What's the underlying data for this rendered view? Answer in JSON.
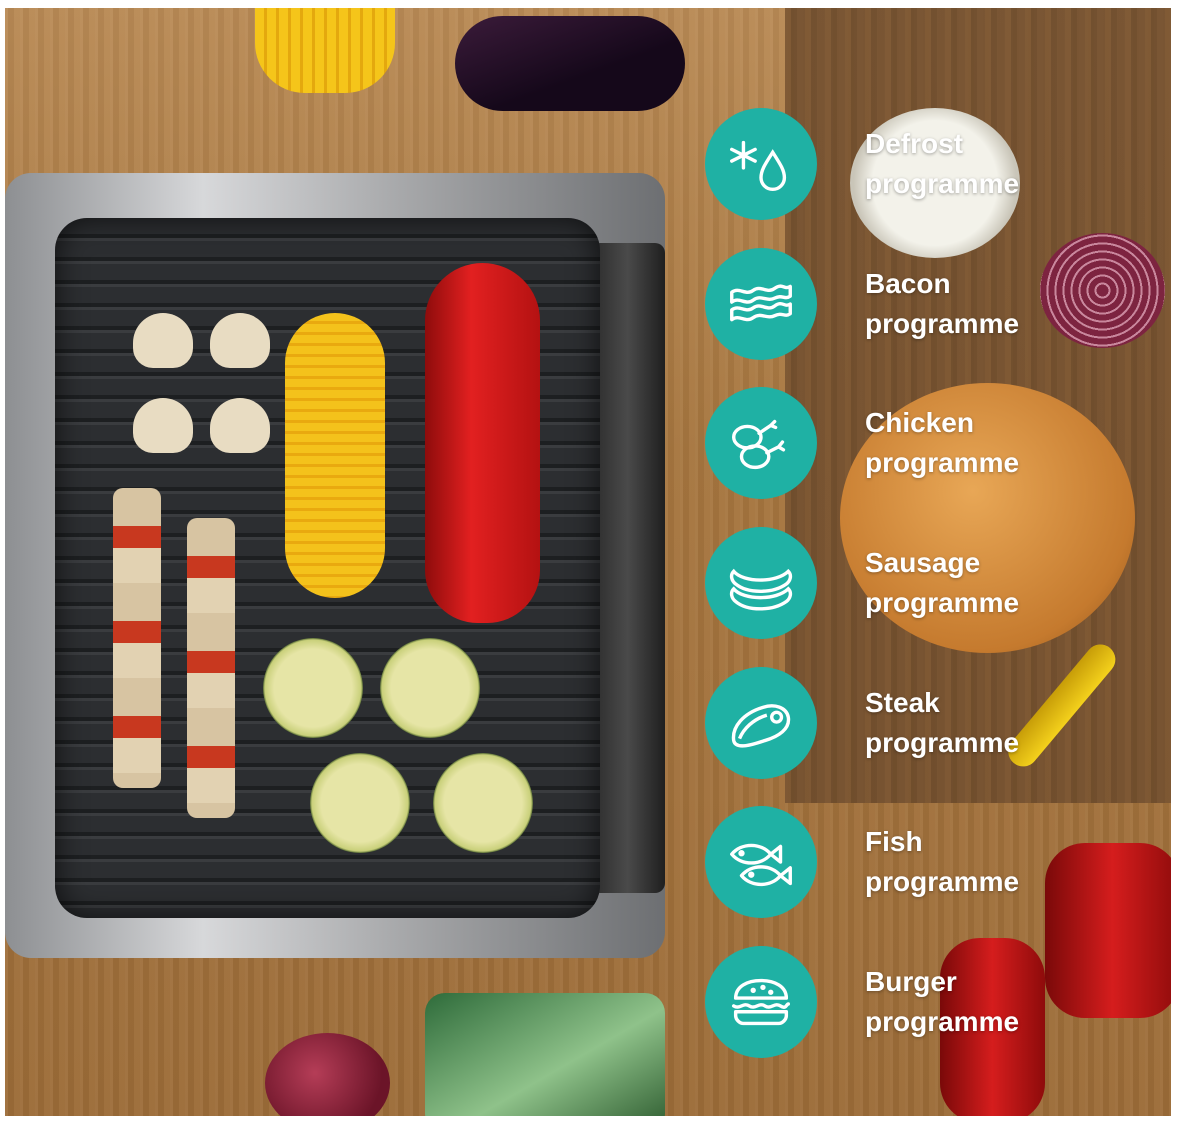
{
  "programmes": [
    {
      "name": "Defrost",
      "suffix": "programme",
      "icon": "defrost-icon"
    },
    {
      "name": "Bacon",
      "suffix": "programme",
      "icon": "bacon-icon"
    },
    {
      "name": "Chicken",
      "suffix": "programme",
      "icon": "chicken-icon"
    },
    {
      "name": "Sausage",
      "suffix": "programme",
      "icon": "sausage-icon"
    },
    {
      "name": "Steak",
      "suffix": "programme",
      "icon": "steak-icon"
    },
    {
      "name": "Fish",
      "suffix": "programme",
      "icon": "fish-icon"
    },
    {
      "name": "Burger",
      "suffix": "programme",
      "icon": "burger-icon"
    }
  ],
  "colors": {
    "badge": "#1fb1a4",
    "label": "#ffffff"
  }
}
